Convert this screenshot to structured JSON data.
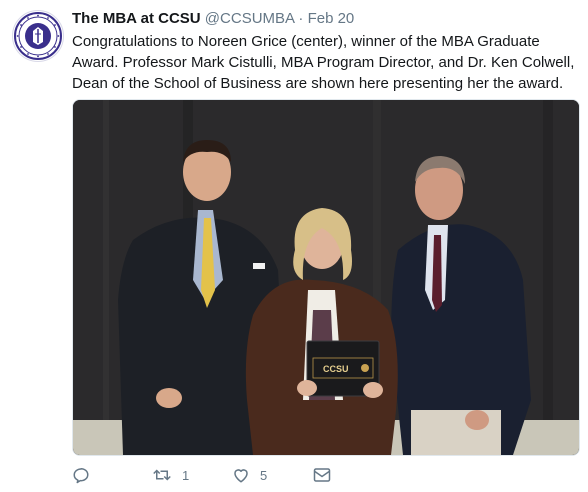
{
  "tweet": {
    "display_name": "The MBA at CCSU",
    "handle": "@CCSUMBA",
    "separator": "·",
    "date": "Feb 20",
    "text": "Congratulations to Noreen Grice (center), winner of the MBA Graduate Award. Professor Mark Cistulli, MBA Program Director, and Dr. Ken Colwell, Dean of the School of Business are shown here presenting her the award.",
    "photo": {
      "certificate_line1": "CCSU"
    },
    "actions": {
      "reply_icon": "reply-icon",
      "retweet_icon": "retweet-icon",
      "retweet_count": "1",
      "like_icon": "heart-icon",
      "like_count": "5",
      "dm_icon": "envelope-icon"
    }
  },
  "colors": {
    "text": "#14171a",
    "muted": "#657786",
    "seal": "#3a2f8c"
  }
}
